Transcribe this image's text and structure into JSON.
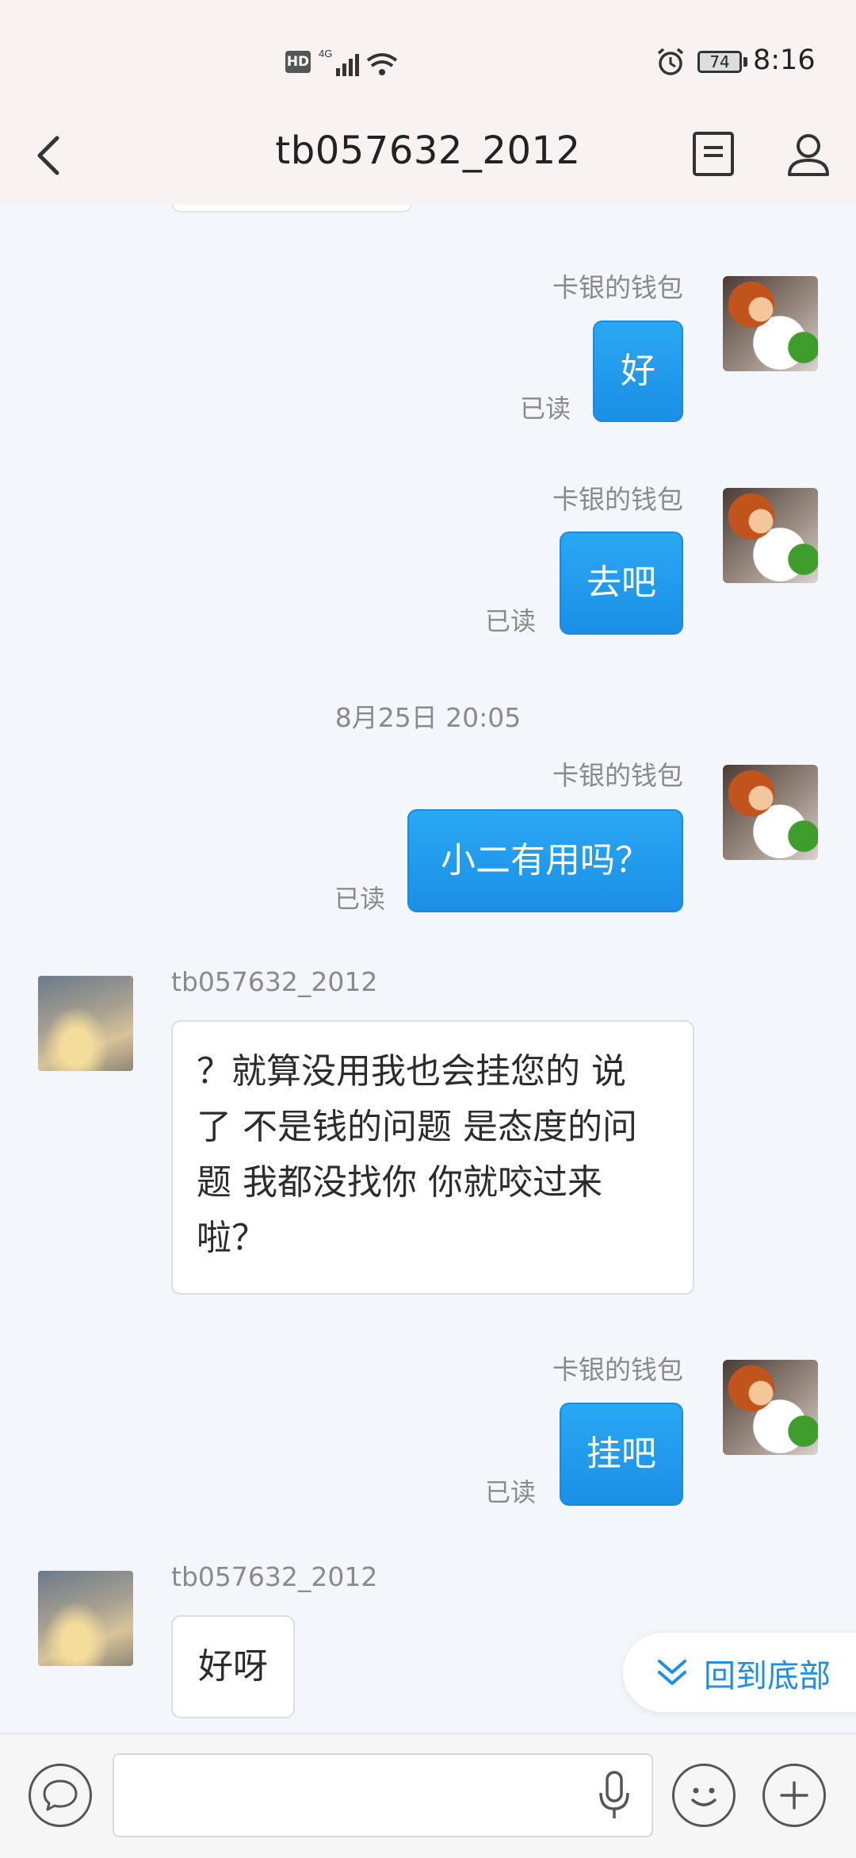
{
  "status_bar": {
    "hd": "HD",
    "network": "4G",
    "battery": "74",
    "time": "8:16"
  },
  "header": {
    "title": "tb057632_2012",
    "icons": [
      "back-icon",
      "document-icon",
      "user-icon"
    ]
  },
  "messages": [
    {
      "type": "out",
      "sender": "卡银的钱包",
      "text": "好",
      "status": "已读"
    },
    {
      "type": "out",
      "sender": "卡银的钱包",
      "text": "去吧",
      "status": "已读"
    },
    {
      "type": "time",
      "text": "8月25日 20:05"
    },
    {
      "type": "out",
      "sender": "卡银的钱包",
      "text": "小二有用吗？",
      "status": "已读"
    },
    {
      "type": "in",
      "sender": "tb057632_2012",
      "lines": [
        "？就算没用我也会挂您的 说",
        "了 不是钱的问题 是态度的问",
        "题 我都没找你 你就咬过来",
        "啦？"
      ]
    },
    {
      "type": "out",
      "sender": "卡银的钱包",
      "text": "挂吧",
      "status": "已读"
    },
    {
      "type": "in",
      "sender": "tb057632_2012",
      "text": "好呀"
    }
  ],
  "jump_to_bottom": "回到底部",
  "colors": {
    "accent": "#1f8fe5",
    "outgoing_bubble": "#1b8fe6",
    "background": "#f3f6fb"
  }
}
